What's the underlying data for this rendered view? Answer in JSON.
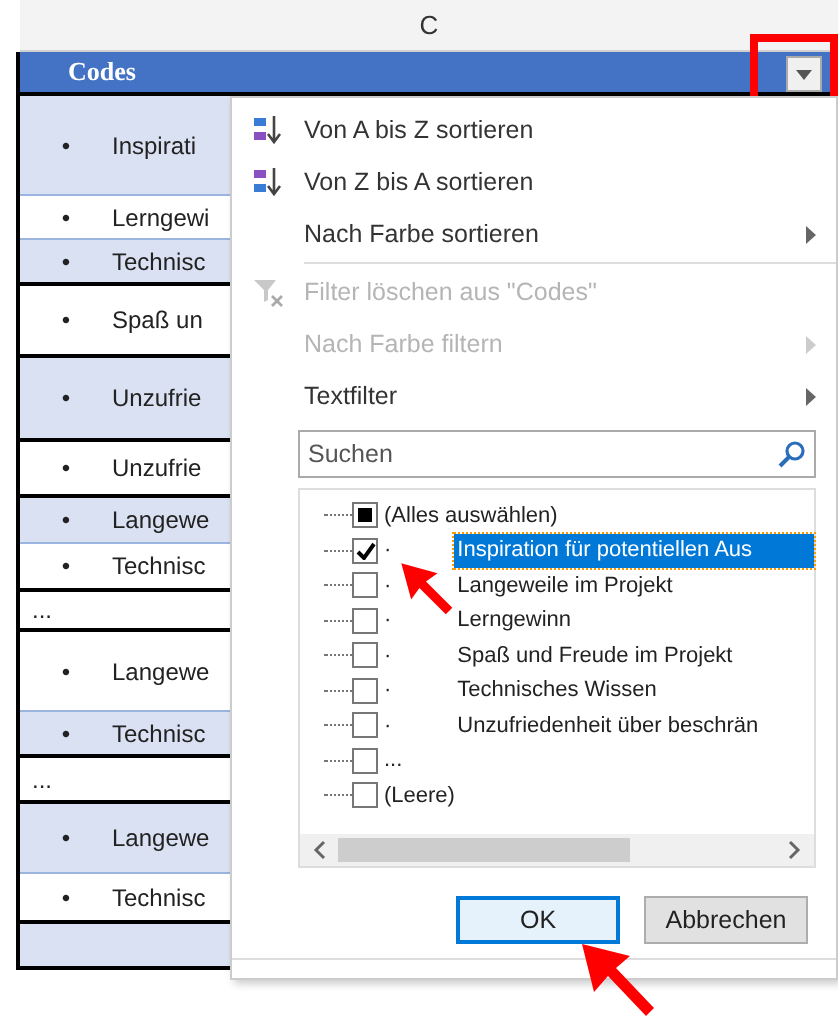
{
  "column_header": "C",
  "table": {
    "header": "Codes",
    "rows": [
      {
        "bullet": "•",
        "text": "Inspirati",
        "shaded": true,
        "group_end": false
      },
      {
        "bullet": "•",
        "text": "Lerngewi",
        "shaded": false,
        "group_end": false
      },
      {
        "bullet": "•",
        "text": "Technisc",
        "shaded": true,
        "group_end": true
      },
      {
        "bullet": "•",
        "text": "Spaß un",
        "shaded": false,
        "group_end": true
      },
      {
        "bullet": "•",
        "text": "Unzufrie",
        "shaded": true,
        "group_end": true
      },
      {
        "bullet": "•",
        "text": "Unzufrie",
        "shaded": false,
        "group_end": true
      },
      {
        "bullet": "•",
        "text": "Langewe",
        "shaded": true,
        "group_end": false
      },
      {
        "bullet": "•",
        "text": "Technisc",
        "shaded": false,
        "group_end": true
      },
      {
        "text": "...",
        "shaded": false,
        "group_end": true
      },
      {
        "bullet": "•",
        "text": "Langewe",
        "shaded": false,
        "group_end": false
      },
      {
        "bullet": "•",
        "text": "Technisc",
        "shaded": true,
        "group_end": true
      },
      {
        "text": "...",
        "shaded": false,
        "group_end": true
      },
      {
        "bullet": "•",
        "text": "Langewe",
        "shaded": true,
        "group_end": false
      },
      {
        "bullet": "•",
        "text": "Technisc",
        "shaded": false,
        "group_end": true
      },
      {
        "shaded": true,
        "group_end": true
      }
    ]
  },
  "menu": {
    "items": [
      {
        "kind": "sort-asc",
        "label": "Von A bis Z sortieren",
        "disabled": false,
        "submenu": false
      },
      {
        "kind": "sort-desc",
        "label": "Von Z bis A sortieren",
        "disabled": false,
        "submenu": false
      },
      {
        "kind": "plain",
        "label": "Nach Farbe sortieren",
        "disabled": false,
        "submenu": true
      },
      {
        "kind": "divider"
      },
      {
        "kind": "clear-filter",
        "label": "Filter löschen aus \"Codes\"",
        "disabled": true,
        "submenu": false
      },
      {
        "kind": "plain",
        "label": "Nach Farbe filtern",
        "disabled": true,
        "submenu": true
      },
      {
        "kind": "plain",
        "label": "Textfilter",
        "disabled": false,
        "submenu": true
      }
    ],
    "search": {
      "placeholder": "Suchen"
    },
    "values": [
      {
        "label": "(Alles auswählen)",
        "checked": false,
        "partial": true,
        "selected": false
      },
      {
        "bullet": "·",
        "label": "Inspiration für potentiellen Aus",
        "checked": true,
        "partial": false,
        "selected": true
      },
      {
        "bullet": "·",
        "label": "Langeweile im Projekt",
        "checked": false,
        "partial": false,
        "selected": false
      },
      {
        "bullet": "·",
        "label": "Lerngewinn",
        "checked": false,
        "partial": false,
        "selected": false
      },
      {
        "bullet": "·",
        "label": "Spaß und Freude im Projekt",
        "checked": false,
        "partial": false,
        "selected": false
      },
      {
        "bullet": "·",
        "label": "Technisches Wissen",
        "checked": false,
        "partial": false,
        "selected": false
      },
      {
        "bullet": "·",
        "label": "Unzufriedenheit über beschrän",
        "checked": false,
        "partial": false,
        "selected": false
      },
      {
        "label": "...",
        "checked": false,
        "partial": false,
        "selected": false
      },
      {
        "label": "(Leere)",
        "checked": false,
        "partial": false,
        "selected": false
      }
    ],
    "buttons": [
      {
        "label": "OK",
        "default": true
      },
      {
        "label": "Abbrechen",
        "default": false
      }
    ]
  }
}
